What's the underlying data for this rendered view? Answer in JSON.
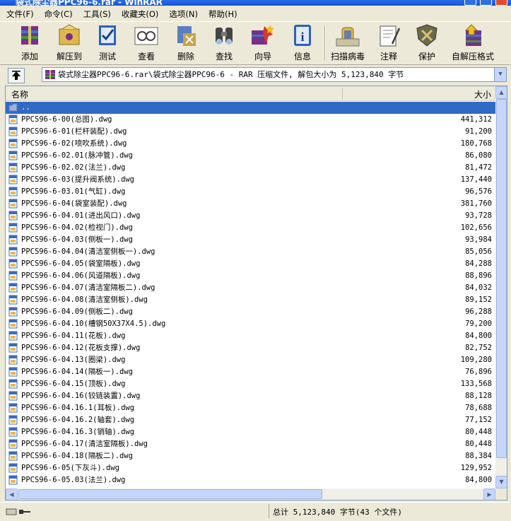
{
  "window": {
    "title": "袋式除尘器PPC96-6.rar - WinRAR"
  },
  "menu": [
    "文件(F)",
    "命令(C)",
    "工具(S)",
    "收藏夹(O)",
    "选项(N)",
    "帮助(H)"
  ],
  "toolbar": [
    {
      "label": "添加",
      "icon": "add-archive-icon"
    },
    {
      "label": "解压到",
      "icon": "extract-icon"
    },
    {
      "label": "测试",
      "icon": "test-icon"
    },
    {
      "label": "查看",
      "icon": "view-icon"
    },
    {
      "label": "删除",
      "icon": "delete-icon"
    },
    {
      "label": "查找",
      "icon": "find-icon"
    },
    {
      "label": "向导",
      "icon": "wizard-icon"
    },
    {
      "label": "信息",
      "icon": "info-icon"
    },
    {
      "label": "扫描病毒",
      "icon": "virus-scan-icon"
    },
    {
      "label": "注释",
      "icon": "comment-icon"
    },
    {
      "label": "保护",
      "icon": "protect-icon"
    },
    {
      "label": "自解压格式",
      "icon": "sfx-icon"
    }
  ],
  "address": {
    "text": "袋式除尘器PPC96-6.rar\\袋式除尘器PPC96-6 - RAR 压缩文件, 解包大小为 5,123,840 字节"
  },
  "columns": {
    "name": "名称",
    "size": "大小"
  },
  "files": [
    {
      "name": "..",
      "size": "",
      "selected": true,
      "folder": true
    },
    {
      "name": "PPCS96-6-00(总图).dwg",
      "size": "441,312"
    },
    {
      "name": "PPCS96-6-01(栏杆装配).dwg",
      "size": "91,200"
    },
    {
      "name": "PPCS96-6-02(喷吹系统).dwg",
      "size": "180,768"
    },
    {
      "name": "PPCS96-6-02.01(脉冲管).dwg",
      "size": "86,080"
    },
    {
      "name": "PPCS96-6-02.02(法兰).dwg",
      "size": "81,472"
    },
    {
      "name": "PPCS96-6-03(提升阀系统).dwg",
      "size": "137,440"
    },
    {
      "name": "PPCS96-6-03.01(气缸).dwg",
      "size": "96,576"
    },
    {
      "name": "PPCS96-6-04(袋室装配).dwg",
      "size": "381,760"
    },
    {
      "name": "PPCS96-6-04.01(进出风口).dwg",
      "size": "93,728"
    },
    {
      "name": "PPCS96-6-04.02(检视门).dwg",
      "size": "102,656"
    },
    {
      "name": "PPCS96-6-04.03(侧板一).dwg",
      "size": "93,984"
    },
    {
      "name": "PPCS96-6-04.04(清洁室侧板一).dwg",
      "size": "85,056"
    },
    {
      "name": "PPCS96-6-04.05(袋室隔板).dwg",
      "size": "84,288"
    },
    {
      "name": "PPCS96-6-04.06(风道隔板).dwg",
      "size": "88,896"
    },
    {
      "name": "PPCS96-6-04.07(清洁室隔板二).dwg",
      "size": "84,032"
    },
    {
      "name": "PPCS96-6-04.08(清洁室侧板).dwg",
      "size": "89,152"
    },
    {
      "name": "PPCS96-6-04.09(侧板二).dwg",
      "size": "96,288"
    },
    {
      "name": "PPCS96-6-04.10(槽钢50X37X4.5).dwg",
      "size": "79,200"
    },
    {
      "name": "PPCS96-6-04.11(花板).dwg",
      "size": "84,800"
    },
    {
      "name": "PPCS96-6-04.12(花板支撑).dwg",
      "size": "82,752"
    },
    {
      "name": "PPCS96-6-04.13(圈梁).dwg",
      "size": "109,280"
    },
    {
      "name": "PPCS96-6-04.14(隔板一).dwg",
      "size": "76,896"
    },
    {
      "name": "PPCS96-6-04.15(顶板).dwg",
      "size": "133,568"
    },
    {
      "name": "PPCS96-6-04.16(铰链装置).dwg",
      "size": "88,128"
    },
    {
      "name": "PPCS96-6-04.16.1(耳板).dwg",
      "size": "78,688"
    },
    {
      "name": "PPCS96-6-04.16.2(轴套).dwg",
      "size": "77,152"
    },
    {
      "name": "PPCS96-6-04.16.3(销轴).dwg",
      "size": "80,448"
    },
    {
      "name": "PPCS96-6-04.17(清洁室隔板).dwg",
      "size": "80,448"
    },
    {
      "name": "PPCS96-6-04.18(隔板二).dwg",
      "size": "88,384"
    },
    {
      "name": "PPCS96-6-05(下灰斗).dwg",
      "size": "129,952"
    },
    {
      "name": "PPCS96-6-05.03(法兰).dwg",
      "size": "84,800"
    }
  ],
  "status": {
    "summary": "总计 5,123,840 字节(43 个文件)"
  }
}
